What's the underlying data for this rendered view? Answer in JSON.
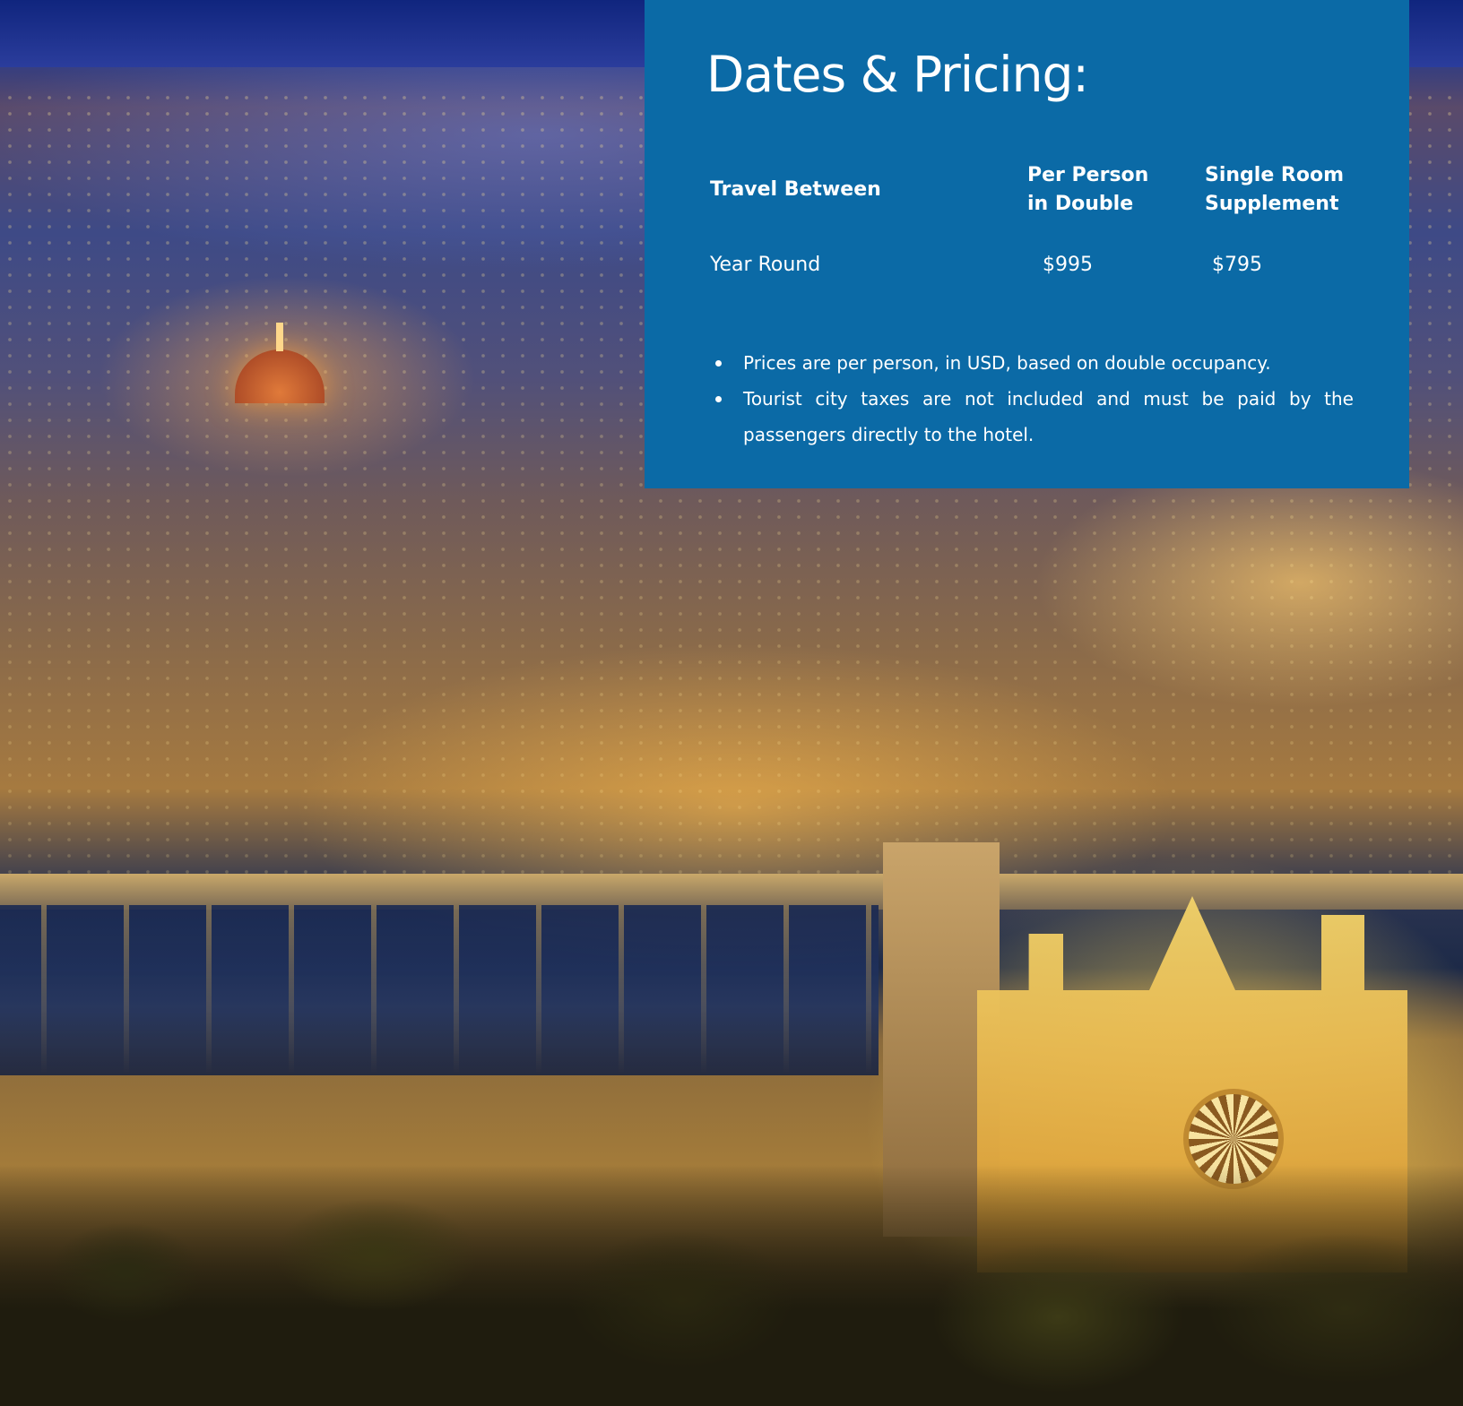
{
  "pricing": {
    "title": "Dates & Pricing:",
    "headers": {
      "travel_between": [
        "Travel Between"
      ],
      "per_person_double": [
        "Per Person",
        "in Double"
      ],
      "single_supplement": [
        "Single Room",
        "Supplement"
      ]
    },
    "rows": [
      {
        "travel_between": "Year Round",
        "per_person_double": "$995",
        "single_supplement": "$795"
      }
    ],
    "notes": [
      "Prices are per person, in USD, based on double occupancy.",
      "Tourist city taxes are not included and must be paid by the passengers directly to the hotel."
    ]
  },
  "colors": {
    "panel_background": "#0b6aa6",
    "text": "#ffffff"
  }
}
